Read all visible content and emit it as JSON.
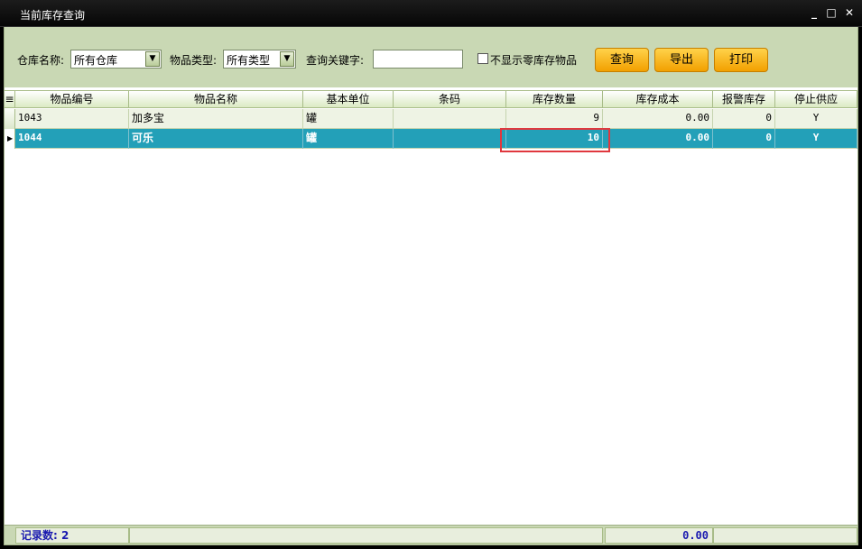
{
  "window": {
    "title": "当前库存查询",
    "min": "_",
    "max": "□",
    "close": "✕"
  },
  "filters": {
    "warehouse_label": "仓库名称:",
    "warehouse_value": "所有仓库",
    "type_label": "物品类型:",
    "type_value": "所有类型",
    "keyword_label": "查询关键字:",
    "keyword_value": "",
    "zero_stock_label": "不显示零库存物品",
    "zero_stock_checked": false
  },
  "buttons": {
    "query": "查询",
    "export": "导出",
    "print": "打印"
  },
  "table": {
    "columns": [
      "物品编号",
      "物品名称",
      "基本单位",
      "条码",
      "库存数量",
      "库存成本",
      "报警库存",
      "停止供应"
    ],
    "rows": [
      {
        "code": "1043",
        "name": "加多宝",
        "unit": "罐",
        "barcode": "",
        "qty": "9",
        "cost": "0.00",
        "alarm": "0",
        "stop": "Y"
      },
      {
        "code": "1044",
        "name": "可乐",
        "unit": "罐",
        "barcode": "",
        "qty": "10",
        "cost": "0.00",
        "alarm": "0",
        "stop": "Y"
      }
    ],
    "selected_row": 1
  },
  "footer": {
    "record_count": "记录数: 2",
    "cost_total": "0.00"
  },
  "colors": {
    "accent_button": "#f2a000",
    "selected_row": "#23a0b8",
    "highlight": "#e0383e",
    "panel": "#c9d8b4"
  }
}
